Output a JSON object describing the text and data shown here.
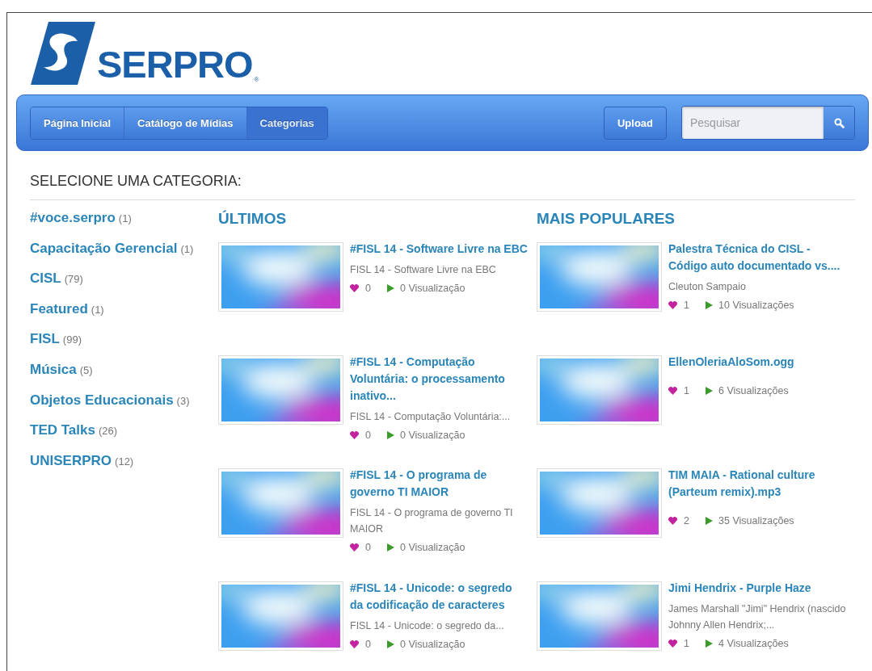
{
  "logo": {
    "text": "SERPRO",
    "mark": "®"
  },
  "nav": {
    "tabs": [
      {
        "label": "Página Inicial",
        "selected": false
      },
      {
        "label": "Catálogo de Mídias",
        "selected": false
      },
      {
        "label": "Categorias",
        "selected": true
      }
    ],
    "upload": "Upload",
    "search": {
      "placeholder": "Pesquisar"
    }
  },
  "heading": "SELECIONE UMA CATEGORIA:",
  "categories": [
    {
      "name": "#voce.serpro",
      "count": "(1)"
    },
    {
      "name": "Capacitação Gerencial",
      "count": "(1)"
    },
    {
      "name": "CISL",
      "count": "(79)"
    },
    {
      "name": "Featured",
      "count": "(1)"
    },
    {
      "name": "FISL",
      "count": "(99)"
    },
    {
      "name": "Música",
      "count": "(5)"
    },
    {
      "name": "Objetos Educacionais",
      "count": "(3)"
    },
    {
      "name": "TED Talks",
      "count": "(26)"
    },
    {
      "name": "UNISERPRO",
      "count": "(12)"
    }
  ],
  "latest": {
    "title": "ÚLTIMOS",
    "items": [
      {
        "title": "#FISL 14 - Software Livre na EBC",
        "description": "FISL 14 - Software Livre na EBC",
        "likes": "0",
        "views": "0 Visualização"
      },
      {
        "title": "#FISL 14 - Computação Voluntária: o processamento inativo...",
        "description": "FISL 14 - Computação Voluntária:...",
        "likes": "0",
        "views": "0 Visualização"
      },
      {
        "title": "#FISL 14 - O programa de governo TI MAIOR",
        "description": "FISL 14 - O programa de governo TI MAIOR",
        "likes": "0",
        "views": "0 Visualização"
      },
      {
        "title": "#FISL 14 - Unicode: o segredo da codificação de caracteres",
        "description": "FISL 14 - Unicode: o segredo da...",
        "likes": "0",
        "views": "0 Visualização"
      }
    ]
  },
  "popular": {
    "title": "MAIS POPULARES",
    "items": [
      {
        "title": "Palestra Técnica do CISL - Código auto documentado vs....",
        "description": "Cleuton Sampaio",
        "likes": "1",
        "views": "10 Visualizações"
      },
      {
        "title": "EllenOleriaAloSom.ogg",
        "likes": "1",
        "views": "6 Visualizações"
      },
      {
        "title": "TIM MAIA - Rational culture (Parteum remix).mp3",
        "likes": "2",
        "views": "35 Visualizações"
      },
      {
        "title": "Jimi Hendrix - Purple Haze",
        "description": "James Marshall \"Jimi\" Hendrix (nascido Johnny Allen Hendrix;...",
        "likes": "1",
        "views": "4 Visualizações"
      }
    ]
  }
}
